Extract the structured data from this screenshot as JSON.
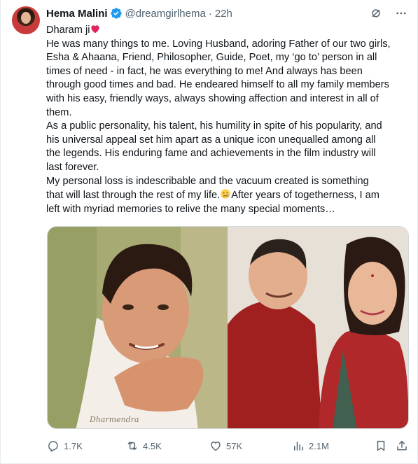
{
  "post": {
    "author_name": "Hema Malini",
    "handle": "@dreamgirlhema",
    "separator": "·",
    "time": "22h",
    "lines": [
      "Dharam ji",
      "He was many things to me. Loving Husband, adoring Father of our two girls,",
      "Esha & Ahaana, Friend, Philosopher, Guide, Poet, my ‘go to’ person in all",
      "times of need - in fact, he was everything to me! And always has been",
      "through good times and bad. He endeared himself to all my family members",
      "with his easy, friendly ways, always showing affection and interest in all of",
      "them.",
      "As a public personality, his talent, his humility in spite of his popularity, and",
      "his universal appeal set him apart as a unique icon unequalled among all",
      "the legends. His enduring fame and achievements in the film industry will",
      "last forever.",
      "My personal loss is indescribable and  the vacuum created is something",
      "that will last through the rest of my life.",
      "After years of togetherness, I am",
      "left with myriad memories to relive the many  special moments…"
    ],
    "signature": "Dharmendra"
  },
  "actions": {
    "replies": "1.7K",
    "reposts": "4.5K",
    "likes": "57K",
    "views": "2.1M"
  },
  "icons": {
    "verified": "verified-badge-icon",
    "grok": "grok-icon",
    "more": "more-icon",
    "heart_emoji": "red-heart-emoji",
    "crying_emoji": "crying-face-emoji",
    "reply": "reply-icon",
    "repost": "repost-icon",
    "like": "like-icon",
    "views": "views-icon",
    "bookmark": "bookmark-icon",
    "share": "share-icon"
  },
  "colors": {
    "verified_blue": "#1d9bf0",
    "secondary_text": "#536471",
    "primary_text": "#0f1419",
    "heart_red": "#e0245e"
  }
}
